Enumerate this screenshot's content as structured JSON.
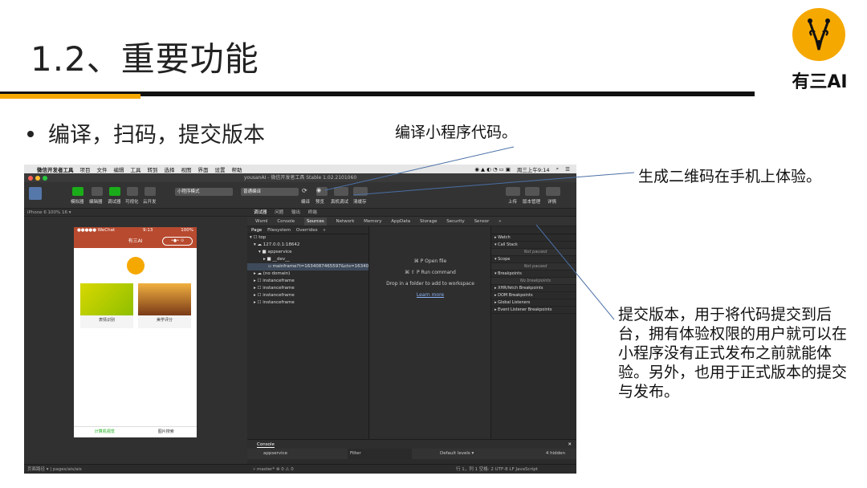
{
  "slide": {
    "title": "1.2、重要功能",
    "logo_text": "有三AI",
    "bullet": "编译，扫码，提交版本",
    "annotation_compile": "编译小程序代码。",
    "annotation_qr": "生成二维码在手机上体验。",
    "annotation_submit": "提交版本，用于将代码提交到后台，拥有体验权限的用户就可以在小程序没有正式发布之前就能体验。另外，也用于正式版本的提交与发布。",
    "colors": {
      "accent": "#f5a800",
      "rule": "#111111"
    }
  },
  "menubar": {
    "app": "微信开发者工具",
    "items": [
      "项目",
      "文件",
      "编辑",
      "工具",
      "转到",
      "选择",
      "视图",
      "界面",
      "设置",
      "帮助"
    ],
    "clock": "周三上午9:14"
  },
  "window": {
    "title": "yousanAI - 微信开发者工具 Stable 1.02.2101060"
  },
  "toolbar": {
    "left_labels": [
      "模拟器",
      "编辑器",
      "调试器",
      "可视化",
      "云开发"
    ],
    "mode_select": "小程序模式",
    "compile_select": "普通编译",
    "mid_labels": [
      "编译",
      "预览",
      "真机调试",
      "清缓存"
    ],
    "right_labels": [
      "上传",
      "版本管理",
      "详情"
    ]
  },
  "simulator": {
    "device": "iPhone 6 100% 16 ▾",
    "status_left": "●●●●● WeChat",
    "status_time": "9:13",
    "status_right": "100%",
    "nav_title": "有三AI",
    "capsule": "•●•  ⊙",
    "cards": [
      "表情识别",
      "美学评分"
    ],
    "tabs": [
      "计算机视觉",
      "图片搜索"
    ]
  },
  "devtools": {
    "top_tabs": [
      "调试器",
      "问题",
      "输出",
      "终端"
    ],
    "tabs": [
      "Wxml",
      "Console",
      "Sources",
      "Network",
      "Memory",
      "AppData",
      "Storage",
      "Security",
      "Sensor",
      "»"
    ],
    "active_tab": "Sources",
    "file_tabs": [
      "Page",
      "Filesystem",
      "Overrides",
      "»"
    ],
    "tree": [
      "▾ ☐ top",
      "  ▾ ☁ 127.0.0.1:18642",
      "    ▾ ■ appservice",
      "      ▸ ■ __dev__",
      "        ▫ mainframe?t=1634087465597&cts=16340874",
      "  ▸ ☁ (no domain)",
      "  ▸ ☐ instanceframe",
      "  ▸ ☐ instanceframe",
      "  ▸ ☐ instanceframe",
      "  ▸ ☐ instanceframe"
    ],
    "editor_lines": [
      "⌘ P     Open file",
      "⌘ ⇧ P     Run command",
      "Drop in a folder to add to workspace",
      "Learn more"
    ],
    "debug_rows": [
      "▸ Watch",
      "▾ Call Stack",
      "Not paused",
      "▾ Scope",
      "Not paused",
      "▾ Breakpoints",
      "No breakpoints",
      "▸ XHR/fetch Breakpoints",
      "▸ DOM Breakpoints",
      "▸ Global Listeners",
      "▸ Event Listener Breakpoints"
    ],
    "console_title": "Console",
    "console_context": "appservice",
    "console_filter": "Filter",
    "console_levels": "Default levels ▾",
    "console_hidden": "4 hidden"
  },
  "statusbar": {
    "left": "页面路径 ▾  |  pages/ais/ais",
    "branch": "⑂ master*   ⊗ 0 ⚠ 0",
    "right": "行 1，列 1   空格: 2   UTF-8   LF   JavaScript"
  }
}
